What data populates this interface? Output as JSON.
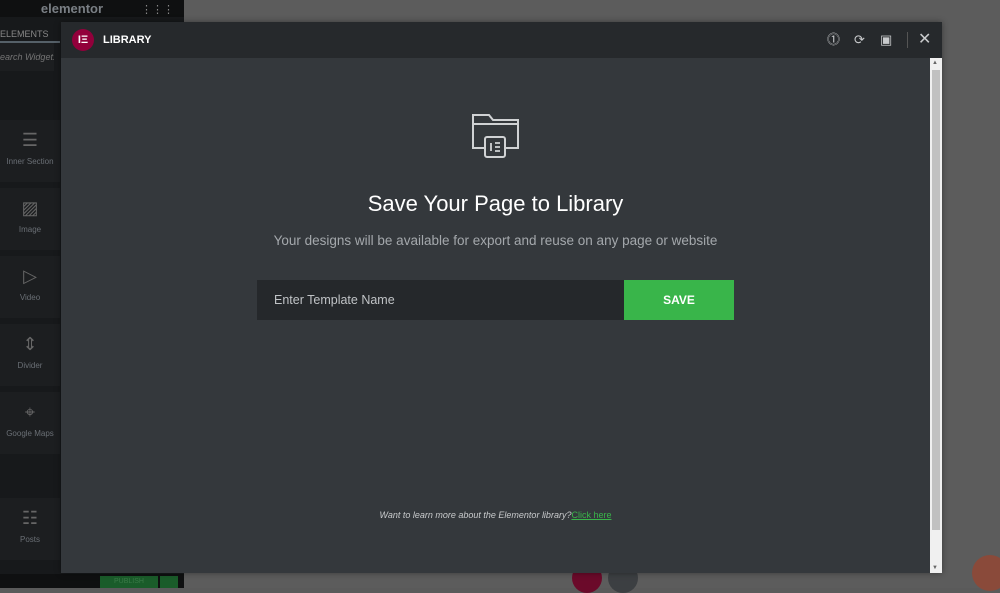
{
  "sidebar": {
    "logo": "elementor",
    "tab": "ELEMENTS",
    "search_placeholder": "Search Widget...",
    "widgets": [
      {
        "label": "Inner Section",
        "icon": "inner-section-icon"
      },
      {
        "label": "Image",
        "icon": "image-icon"
      },
      {
        "label": "Video",
        "icon": "video-icon"
      },
      {
        "label": "Divider",
        "icon": "divider-icon"
      },
      {
        "label": "Google Maps",
        "icon": "map-icon"
      },
      {
        "label": "Posts",
        "icon": "posts-icon"
      }
    ],
    "publish": "PUBLISH"
  },
  "modal": {
    "title": "LIBRARY",
    "heading": "Save Your Page to Library",
    "subheading": "Your designs will be available for export and reuse on any page or website",
    "input_placeholder": "Enter Template Name",
    "save_label": "SAVE",
    "footer_text": "Want to learn more about the Elementor library?",
    "footer_link": "Click here"
  },
  "colors": {
    "accent": "#39b54a",
    "brand": "#92003b",
    "modal_bg": "#34383c",
    "header_bg": "#26292c"
  }
}
